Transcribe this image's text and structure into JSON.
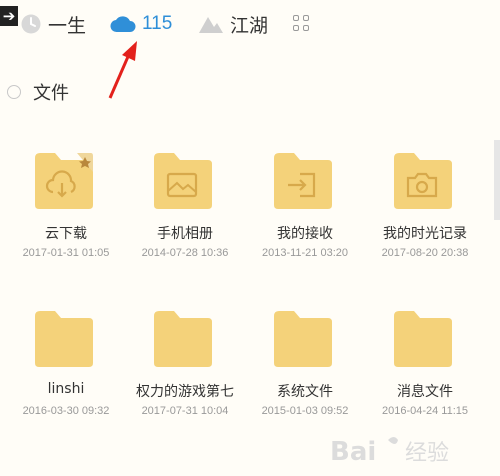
{
  "nav": {
    "items": [
      {
        "label": "一生",
        "icon": "clock-icon"
      },
      {
        "label": "115",
        "icon": "cloud-icon"
      },
      {
        "label": "江湖",
        "icon": "mountain-icon"
      }
    ],
    "grid_icon": "grid-icon",
    "accent": "#2f8fd8"
  },
  "files": {
    "title": "文件",
    "items": [
      {
        "name": "云下载",
        "date": "2017-01-31 01:05",
        "icon": "cloud-download-icon"
      },
      {
        "name": "手机相册",
        "date": "2014-07-28 10:36",
        "icon": "image-icon"
      },
      {
        "name": "我的接收",
        "date": "2013-11-21 03:20",
        "icon": "inbox-icon"
      },
      {
        "name": "我的时光记录",
        "date": "2017-08-20 20:38",
        "icon": "camera-icon"
      },
      {
        "name": "linshi",
        "date": "2016-03-30 09:32",
        "icon": "folder-icon"
      },
      {
        "name": "权力的游戏第七",
        "date": "2017-07-31 10:04",
        "icon": "folder-icon"
      },
      {
        "name": "系统文件",
        "date": "2015-01-03 09:52",
        "icon": "folder-icon"
      },
      {
        "name": "消息文件",
        "date": "2016-04-24 11:15",
        "icon": "folder-icon"
      }
    ]
  },
  "colors": {
    "folder": "#f4d27a",
    "folder_icon": "#d7a94b",
    "star_tag": "#f0d79b"
  }
}
